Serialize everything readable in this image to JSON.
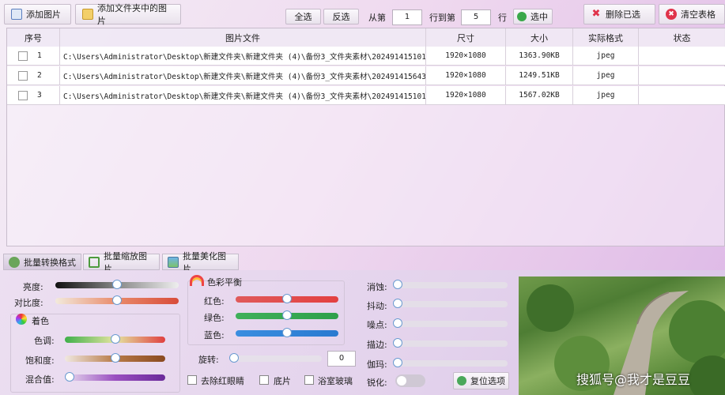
{
  "toolbar": {
    "add_image": "添加图片",
    "add_folder": "添加文件夹中的图片",
    "select_all": "全选",
    "invert": "反选",
    "from_label": "从第",
    "from_value": "1",
    "to_label": "行到第",
    "to_value": "5",
    "row_label": "行",
    "select_label": "选中",
    "delete_selected": "删除已选",
    "clear_table": "清空表格"
  },
  "table": {
    "columns": [
      "序号",
      "图片文件",
      "尺寸",
      "大小",
      "实际格式",
      "状态"
    ],
    "rows": [
      {
        "index": "1",
        "file": "C:\\Users\\Administrator\\Desktop\\新建文件夹\\新建文件夹 (4)\\备份3_文件夹素材\\202491415101",
        "size": "1920×1080",
        "bytes": "1363.90KB",
        "format": "jpeg",
        "status": ""
      },
      {
        "index": "2",
        "file": "C:\\Users\\Administrator\\Desktop\\新建文件夹\\新建文件夹 (4)\\备份3_文件夹素材\\202491415643",
        "size": "1920×1080",
        "bytes": "1249.51KB",
        "format": "jpeg",
        "status": ""
      },
      {
        "index": "3",
        "file": "C:\\Users\\Administrator\\Desktop\\新建文件夹\\新建文件夹 (4)\\备份3_文件夹素材\\202491415101",
        "size": "1920×1080",
        "bytes": "1567.02KB",
        "format": "jpeg",
        "status": ""
      }
    ]
  },
  "tabs": [
    "批量转换格式",
    "批量缩放图片",
    "批量美化图片"
  ],
  "panel": {
    "brightness": "亮度:",
    "contrast": "对比度:",
    "tint_title": "着色",
    "hue": "色调:",
    "saturation": "饱和度:",
    "mix": "混合值:",
    "balance_title": "色彩平衡",
    "red": "红色:",
    "green": "绿色:",
    "blue": "蓝色:",
    "rotate": "旋转:",
    "rotate_value": "0",
    "redeye": "去除红眼睛",
    "negative": "底片",
    "frosted": "浴室玻璃",
    "erode": "消蚀:",
    "jitter": "抖动:",
    "noise": "噪点:",
    "edge": "描边:",
    "gamma": "伽玛:",
    "sharpen": "锐化:",
    "reset": "复位选项"
  },
  "levels": {
    "brightness": 0.5,
    "contrast": 0.5,
    "hue": 0.5,
    "saturation": 0.5,
    "mix": 0.0,
    "red": 0.5,
    "green": 0.5,
    "blue": 0.5,
    "rotate": 0.0,
    "erode": 0.0,
    "jitter": 0.0,
    "noise": 0.0,
    "edge": 0.0,
    "gamma": 0.0
  },
  "watermark": "搜狐号@我才是豆豆",
  "colors": {
    "delete_icon": "#e0334a",
    "clear_icon": "#e0334a",
    "add_icon": "#5a7fc0",
    "check": "#3aa84a"
  }
}
